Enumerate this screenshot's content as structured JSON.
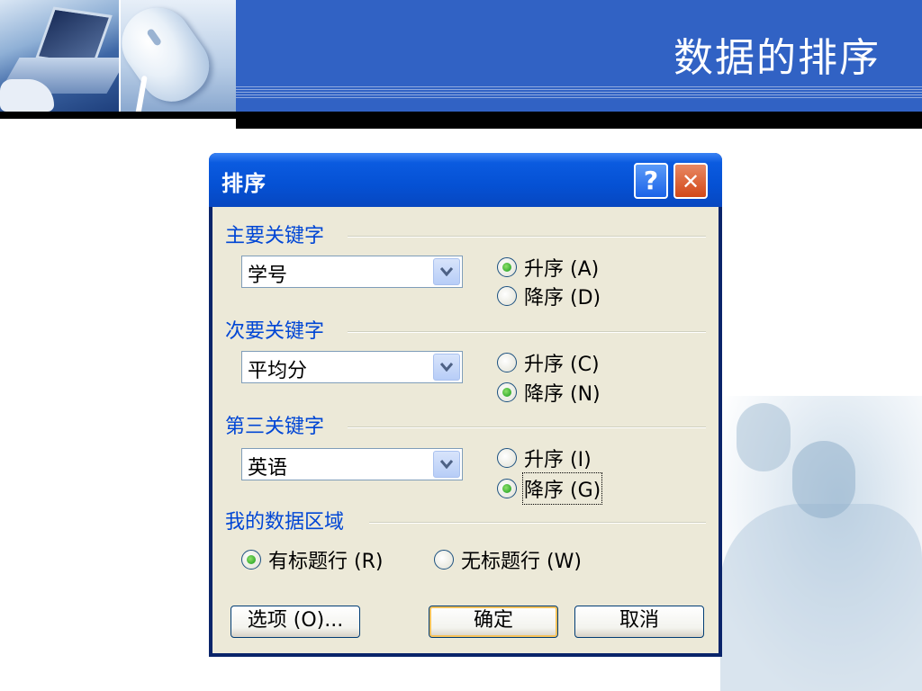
{
  "slide": {
    "title": "数据的排序"
  },
  "dialog": {
    "title": "排序",
    "help_glyph": "?",
    "close_glyph": "✕",
    "primary": {
      "group_label": "主要关键字",
      "field_value": "学号",
      "ascending": "升序 (A)",
      "descending": "降序 (D)",
      "selected": "ascending"
    },
    "secondary": {
      "group_label": "次要关键字",
      "field_value": "平均分",
      "ascending": "升序 (C)",
      "descending": "降序 (N)",
      "selected": "descending"
    },
    "tertiary": {
      "group_label": "第三关键字",
      "field_value": "英语",
      "ascending": "升序 (I)",
      "descending": "降序 (G)",
      "selected": "descending"
    },
    "range": {
      "group_label": "我的数据区域",
      "header_row": "有标题行 (R)",
      "no_header_row": "无标题行 (W)",
      "selected": "header_row"
    },
    "buttons": {
      "options": "选项 (O)...",
      "ok": "确定",
      "cancel": "取消"
    }
  },
  "colors": {
    "titlebar": "#0551d4",
    "group_label": "#0046d5",
    "dialog_body": "#ece9d8",
    "header_band": "#3162c4"
  }
}
